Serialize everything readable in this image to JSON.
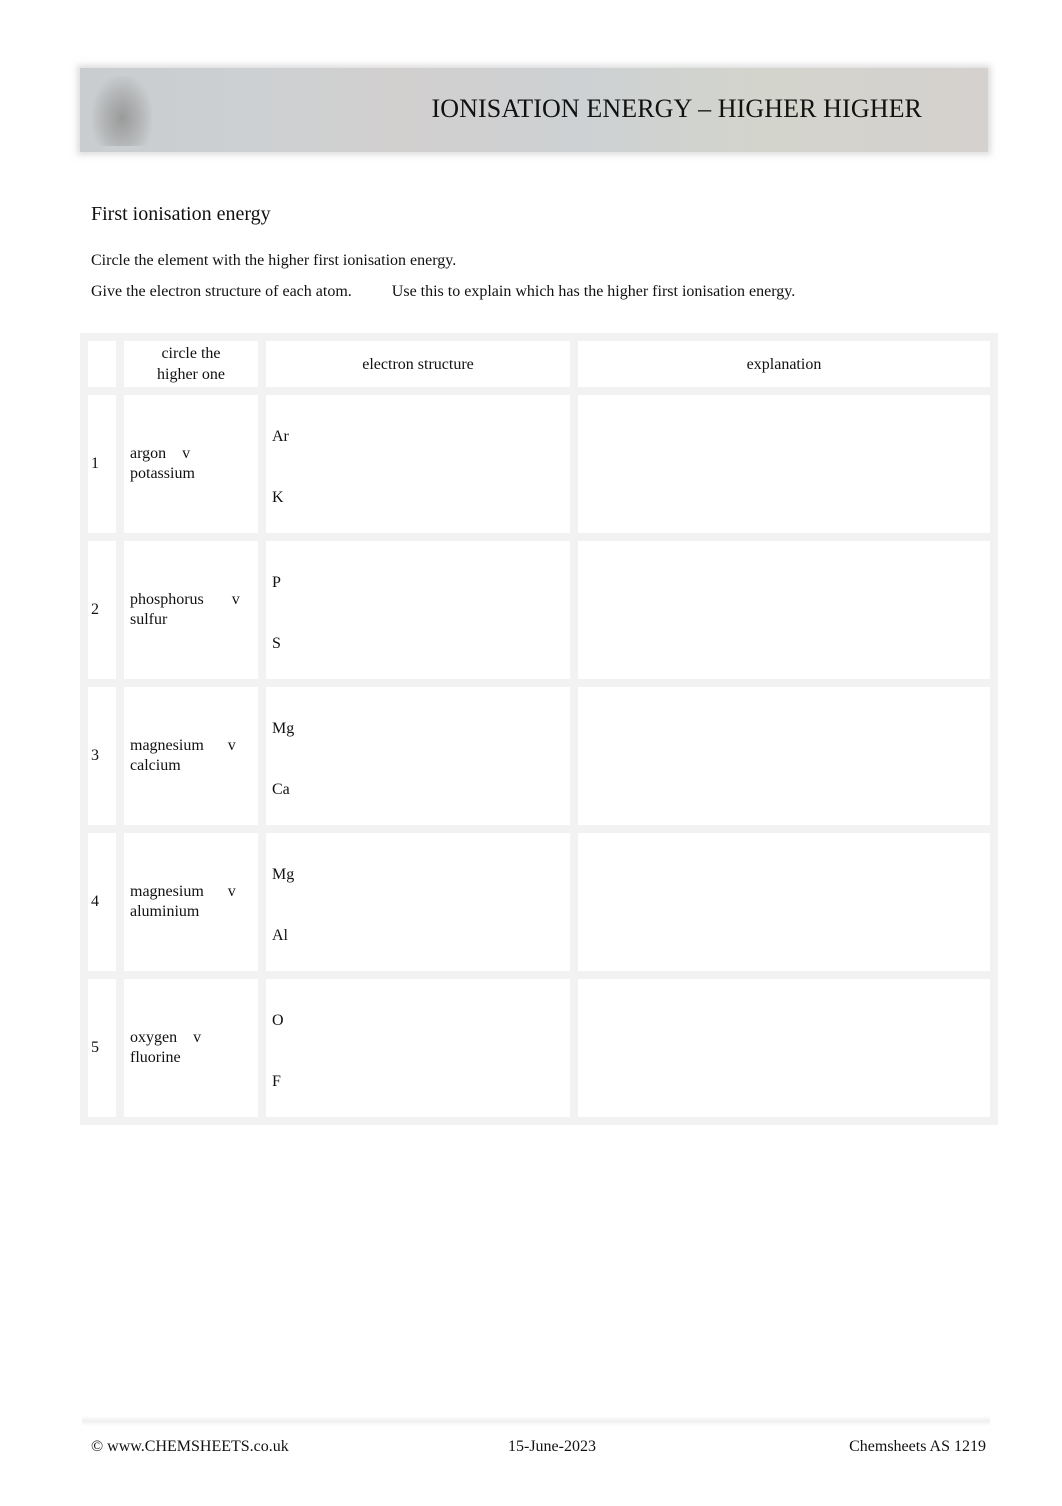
{
  "header": {
    "title": "IONISATION ENERGY – HIGHER HIGHER"
  },
  "section": {
    "title": "First ionisation energy",
    "instruction_1": "Circle the element with the higher first ionisation energy.",
    "instruction_2a": "Give the electron structure of each atom.",
    "instruction_2b": "Use this to explain which has the higher first ionisation energy."
  },
  "table": {
    "headers": [
      "",
      "circle the higher one",
      "electron structure",
      "explanation"
    ],
    "header_pair_line1": "circle the",
    "header_pair_line2": "higher one",
    "rows": [
      {
        "num": "1",
        "element_a": "argon",
        "versus": "v",
        "element_b": "potassium",
        "symbol_a": "Ar",
        "symbol_b": "K",
        "explanation": ""
      },
      {
        "num": "2",
        "element_a": "phosphorus",
        "versus": "v",
        "element_b": "sulfur",
        "symbol_a": "P",
        "symbol_b": "S",
        "explanation": ""
      },
      {
        "num": "3",
        "element_a": "magnesium",
        "versus": "v",
        "element_b": "calcium",
        "symbol_a": "Mg",
        "symbol_b": "Ca",
        "explanation": ""
      },
      {
        "num": "4",
        "element_a": "magnesium",
        "versus": "v",
        "element_b": "aluminium",
        "symbol_a": "Mg",
        "symbol_b": "Al",
        "explanation": ""
      },
      {
        "num": "5",
        "element_a": "oxygen",
        "versus": "v",
        "element_b": "fluorine",
        "symbol_a": "O",
        "symbol_b": "F",
        "explanation": ""
      }
    ]
  },
  "footer": {
    "copyright": "© www.CHEMSHEETS.co.uk",
    "date": "15-June-2023",
    "reference": "Chemsheets AS 1219"
  }
}
